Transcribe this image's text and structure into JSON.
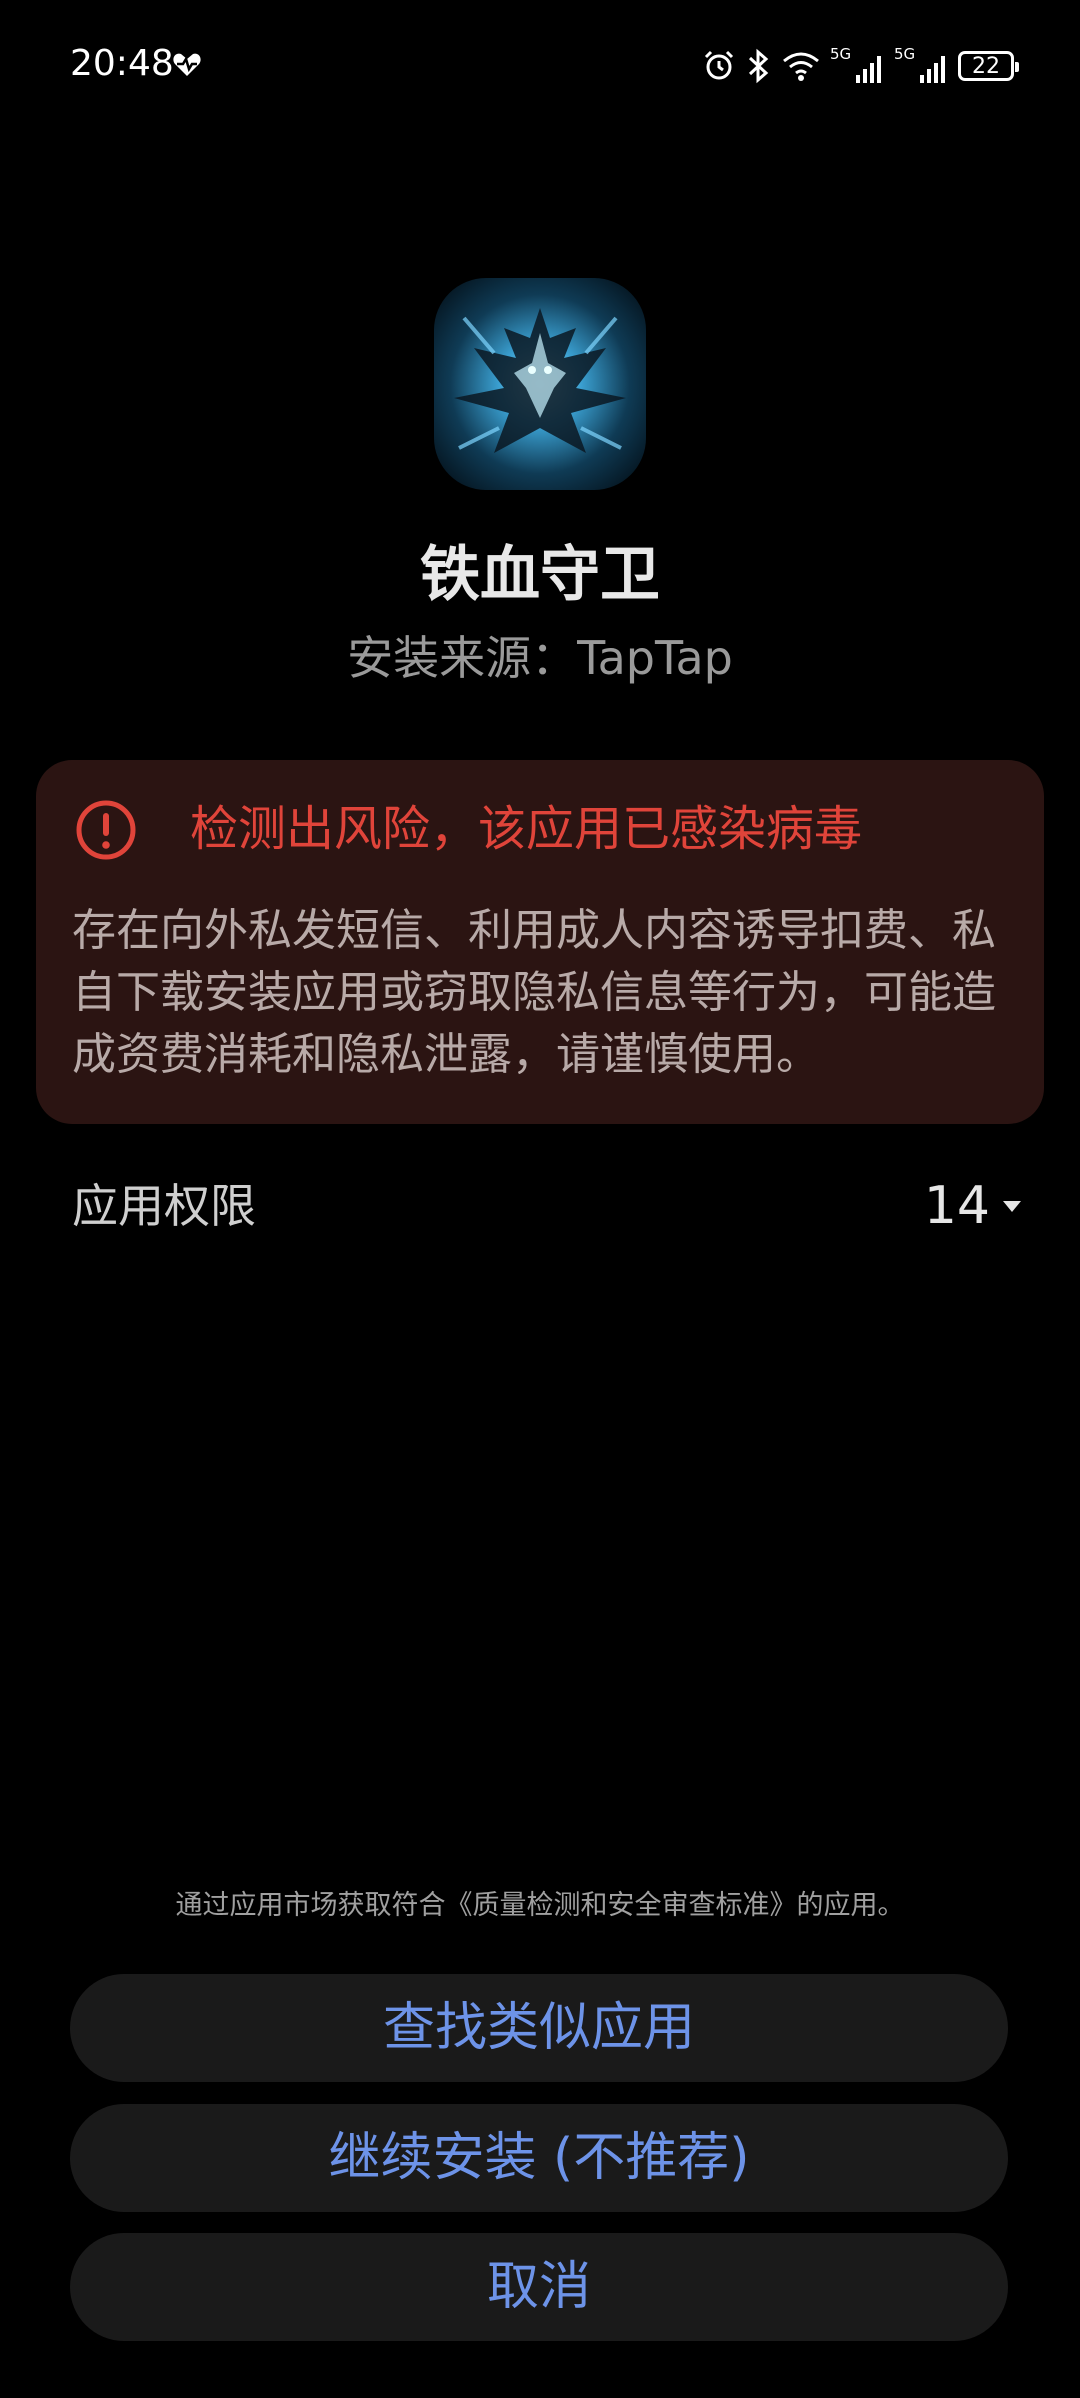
{
  "status_bar": {
    "time": "20:48",
    "battery_level": "22",
    "network_label_1": "5G",
    "network_label_2": "5G",
    "icons": [
      "alarm-icon",
      "bluetooth-icon",
      "wifi-icon",
      "signal-icon",
      "signal-icon",
      "battery-icon"
    ]
  },
  "app": {
    "name": "铁血守卫",
    "install_source": "安装来源：TapTap"
  },
  "warning": {
    "title": "检测出风险，该应用已感染病毒",
    "description": "存在向外私发短信、利用成人内容诱导扣费、私自下载安装应用或窃取隐私信息等行为，可能造成资费消耗和隐私泄露，请谨慎使用。",
    "accent_color": "#e0443a"
  },
  "permissions": {
    "label": "应用权限",
    "count": "14"
  },
  "footer": {
    "note": "通过应用市场获取符合《质量检测和安全审查标准》的应用。"
  },
  "buttons": {
    "find_similar": "查找类似应用",
    "continue_install": "继续安装 (不推荐)",
    "cancel": "取消",
    "text_color": "#6d93e8"
  }
}
